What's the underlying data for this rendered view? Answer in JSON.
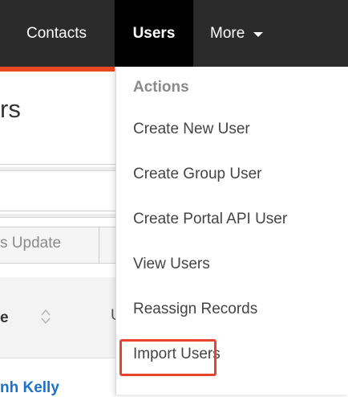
{
  "nav": {
    "items": [
      {
        "label": "Contacts"
      },
      {
        "label": "Users"
      },
      {
        "label": "More"
      }
    ]
  },
  "page": {
    "title_fragment": "rs",
    "action_button_fragment": "s Update",
    "column_header_fragment": "e",
    "next_column_fragment": "U",
    "first_row_link_fragment": "nh Kelly"
  },
  "menu": {
    "header": "Actions",
    "items": [
      {
        "label": "Create New User"
      },
      {
        "label": "Create Group User"
      },
      {
        "label": "Create Portal API User"
      },
      {
        "label": "View Users"
      },
      {
        "label": "Reassign Records"
      },
      {
        "label": "Import Users"
      }
    ],
    "highlighted_item": "Import Users"
  },
  "colors": {
    "nav_background": "#2b2b2b",
    "active_tab": "#000000",
    "accent": "#e8471f",
    "highlight_box": "#e8432d",
    "link": "#1a73c8"
  }
}
